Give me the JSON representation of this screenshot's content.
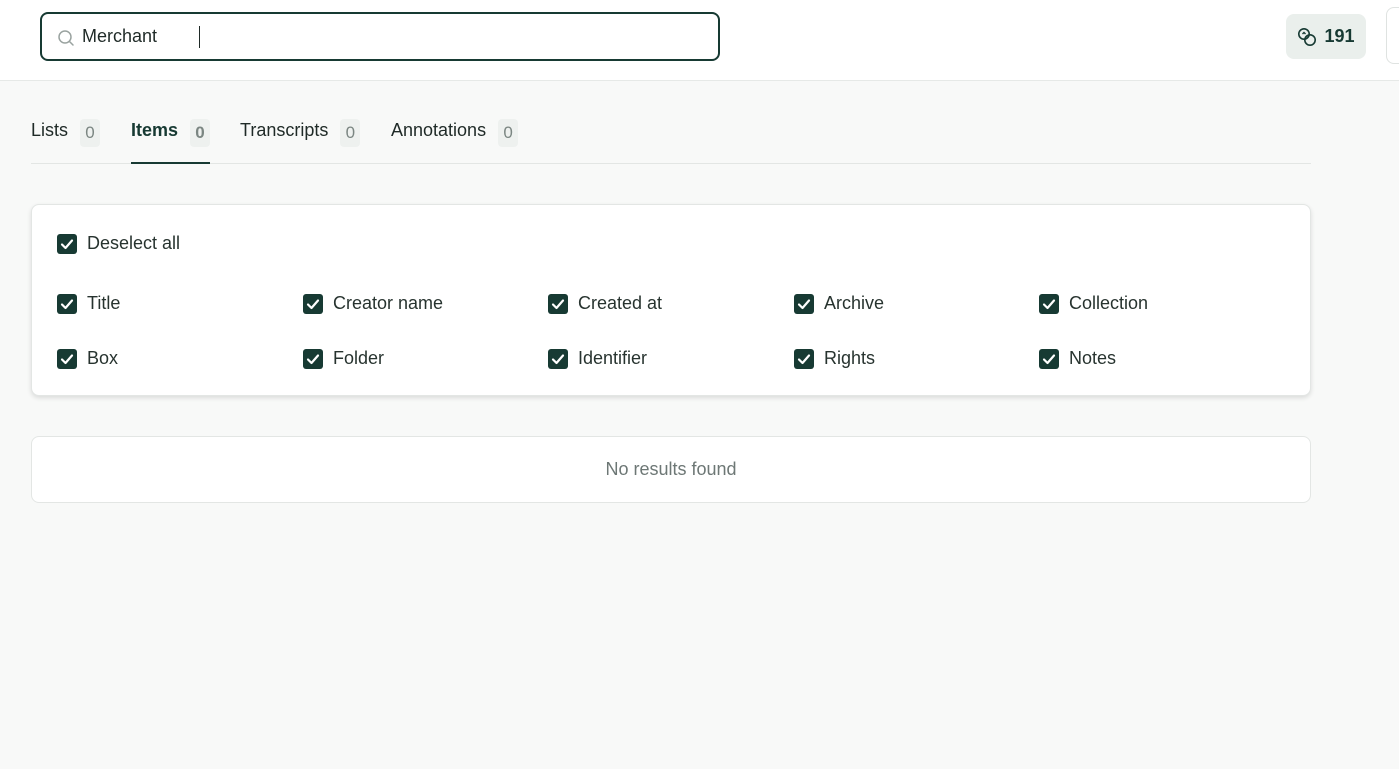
{
  "search": {
    "value": "Merchant",
    "placeholder": ""
  },
  "credits": {
    "value": "191"
  },
  "tabs": [
    {
      "label": "Lists",
      "count": "0"
    },
    {
      "label": "Items",
      "count": "0"
    },
    {
      "label": "Transcripts",
      "count": "0"
    },
    {
      "label": "Annotations",
      "count": "0"
    }
  ],
  "filters": {
    "deselect_all": "Deselect all",
    "fields": [
      "Title",
      "Creator name",
      "Created at",
      "Archive",
      "Collection",
      "Box",
      "Folder",
      "Identifier",
      "Rights",
      "Notes"
    ]
  },
  "results": {
    "empty_text": "No results found"
  },
  "colors": {
    "accent": "#173a33",
    "background": "#f8f9f8"
  }
}
